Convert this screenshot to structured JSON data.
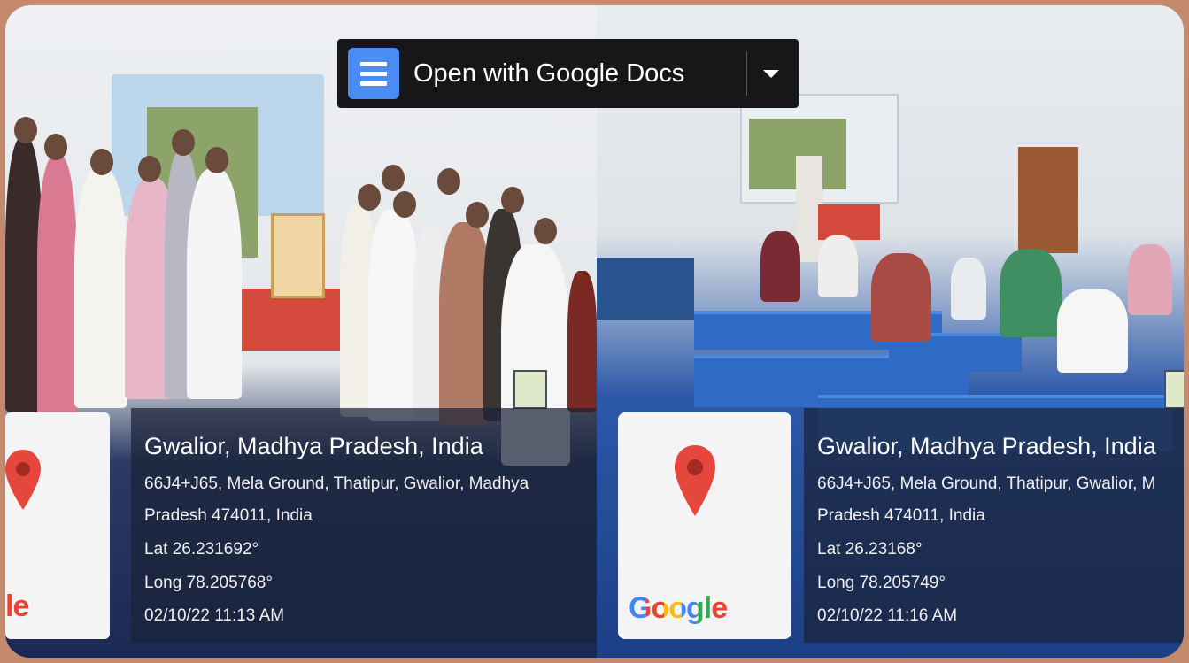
{
  "toolbar": {
    "open_with_label": "Open with Google Docs"
  },
  "photos": [
    {
      "place": "Gwalior, Madhya Pradesh, India",
      "address_line1": "66J4+J65, Mela Ground, Thatipur, Gwalior, Madhya",
      "address_line2": "Pradesh 474011, India",
      "lat": "Lat 26.231692°",
      "long": "Long 78.205768°",
      "datetime": "02/10/22 11:13 AM",
      "map_brand_fragment": "le"
    },
    {
      "place": "Gwalior, Madhya Pradesh, India",
      "address_line1": "66J4+J65, Mela Ground, Thatipur, Gwalior, M",
      "address_line2": "Pradesh 474011, India",
      "lat": "Lat 26.23168°",
      "long": "Long 78.205749°",
      "datetime": "02/10/22 11:16 AM",
      "map_brand": "Google"
    }
  ],
  "icons": {
    "docs": "google-docs-icon",
    "dropdown": "chevron-down-icon",
    "pin": "map-pin-icon"
  },
  "colors": {
    "pin_red": "#e5473c",
    "docs_blue": "#4a8cf2",
    "border": "#c48a6e"
  }
}
